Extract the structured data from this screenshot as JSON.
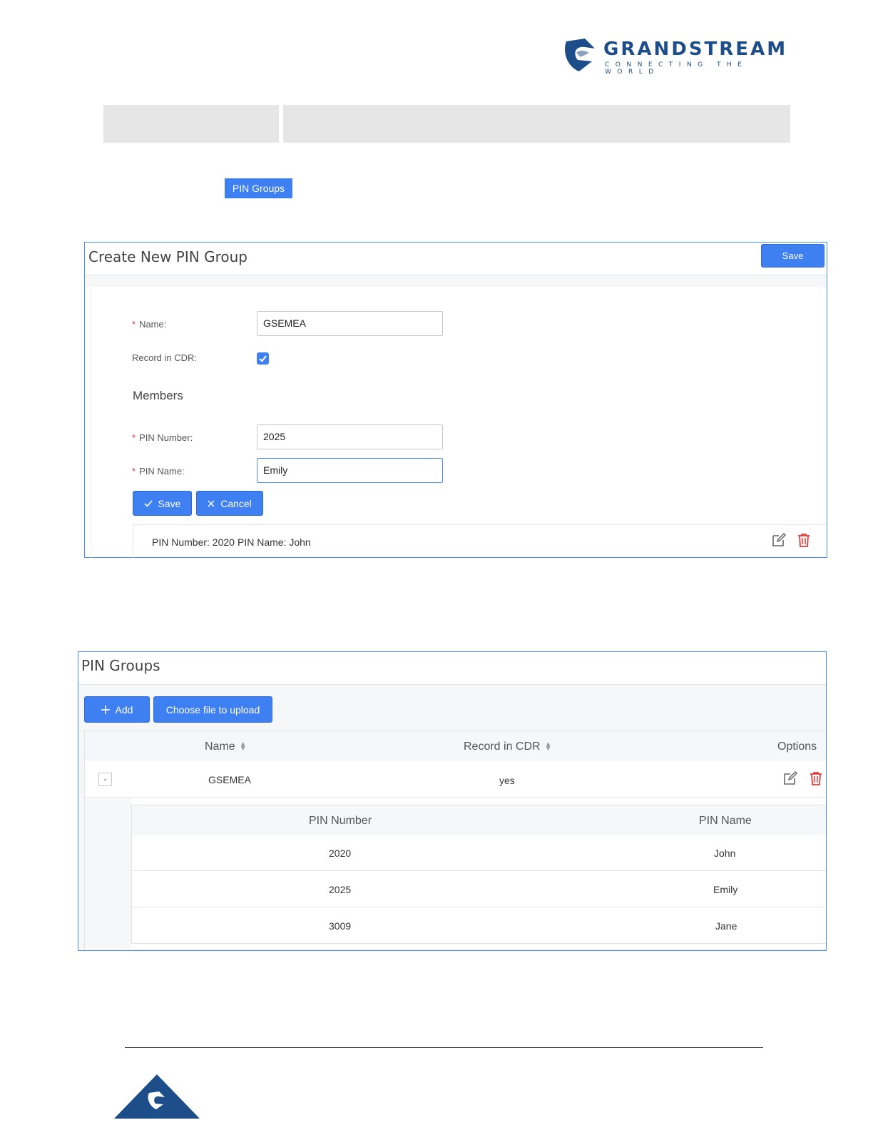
{
  "brand": {
    "name": "GRANDSTREAM",
    "tagline": "CONNECTING THE WORLD",
    "color": "#1d4e89"
  },
  "tag_button": "PIN Groups",
  "create_panel": {
    "title": "Create New PIN Group",
    "save_top": "Save",
    "name_label": "Name:",
    "name_value": "GSEMEA",
    "record_label": "Record in CDR:",
    "record_checked": true,
    "members_heading": "Members",
    "pin_number_label": "PIN Number:",
    "pin_number_value": "2025",
    "pin_name_label": "PIN Name:",
    "pin_name_value": "Emily",
    "save_button": "Save",
    "cancel_button": "Cancel",
    "member_entry": {
      "number_text": "PIN Number: 2020",
      "name_text": "PIN Name: John"
    }
  },
  "groups_panel": {
    "title": "PIN Groups",
    "add_button": "Add",
    "upload_button": "Choose file to upload",
    "columns": {
      "name": "Name",
      "record": "Record in CDR",
      "options": "Options"
    },
    "row": {
      "expander": "-",
      "name": "GSEMEA",
      "record": "yes"
    },
    "sub_table": {
      "columns": {
        "number": "PIN Number",
        "name": "PIN Name"
      },
      "rows": [
        {
          "number": "2020",
          "name": "John"
        },
        {
          "number": "2025",
          "name": "Emily"
        },
        {
          "number": "3009",
          "name": "Jane"
        }
      ]
    }
  },
  "colors": {
    "accent": "#3e7ff2",
    "border": "#4a8ef0",
    "delete": "#e03b3b"
  }
}
